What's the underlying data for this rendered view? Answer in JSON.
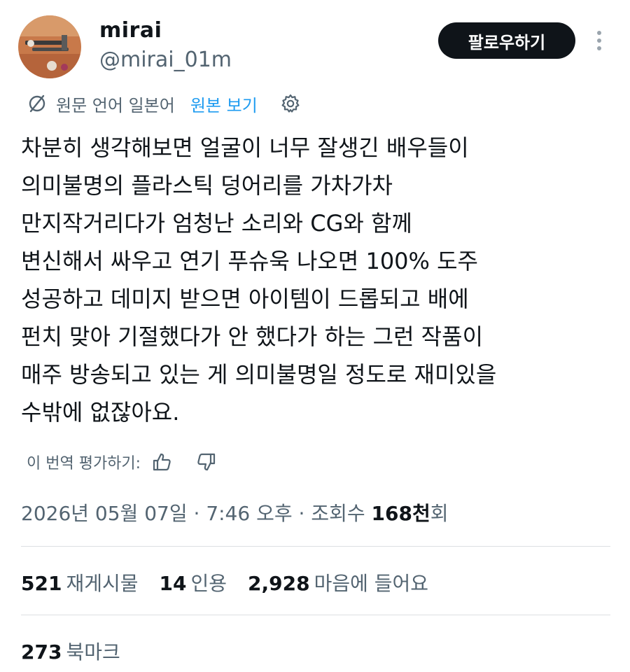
{
  "author": {
    "name": "mirai",
    "handle": "@mirai_01m",
    "follow_label": "팔로우하기"
  },
  "translation": {
    "source_language": "원문 언어 일본어",
    "view_original_label": "원본 보기"
  },
  "tweet": {
    "lines": [
      "차분히 생각해보면 얼굴이 너무 잘생긴 배우들이",
      "의미불명의 플라스틱 덩어리를 가차가차",
      "만지작거리다가 엄청난 소리와 CG와 함께",
      "변신해서 싸우고 연기 푸슈욱 나오면 100% 도주",
      "성공하고 데미지 받으면 아이템이 드롭되고 배에",
      "펀치 맞아 기절했다가 안 했다가 하는 그런 작품이",
      "매주 방송되고 있는 게 의미불명일 정도로 재미있을",
      "수밖에 없잖아요."
    ]
  },
  "rate_translation": {
    "label": "이 번역 평가하기:"
  },
  "meta": {
    "date": "2026년 05월 07일",
    "time": "7:46 오후",
    "views_label": "조회수",
    "views_count": "168천",
    "views_suffix": "회",
    "separator": " · "
  },
  "stats": {
    "retweets_count": "521",
    "retweets_label": "재게시물",
    "quotes_count": "14",
    "quotes_label": "인용",
    "likes_count": "2,928",
    "likes_label": "마음에 들어요",
    "bookmarks_count": "273",
    "bookmarks_label": "북마크"
  },
  "colors": {
    "accent": "#1d9bf0",
    "text_primary": "#0f1419",
    "text_secondary": "#536471",
    "button_bg": "#0f1419"
  },
  "icons": {
    "translate": "translate-icon",
    "settings": "gear-icon",
    "thumbs_up": "thumbs-up-icon",
    "thumbs_down": "thumbs-down-icon",
    "more": "more-vertical-icon"
  }
}
